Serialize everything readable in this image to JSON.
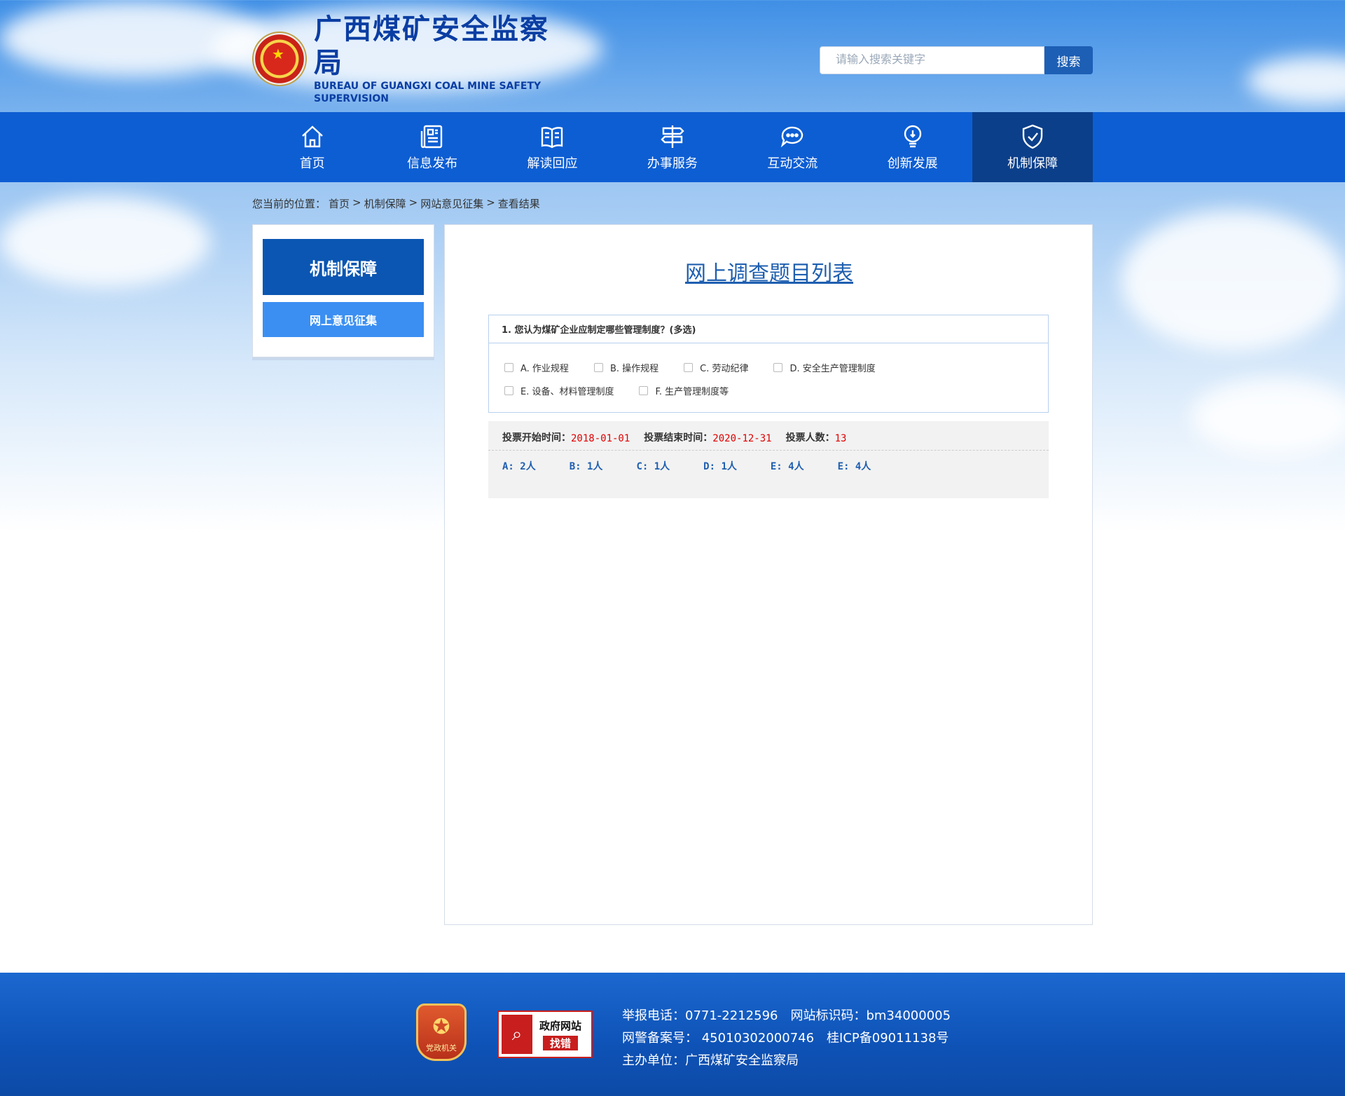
{
  "header": {
    "logo_cn": "广西煤矿安全监察局",
    "logo_en": "BUREAU OF GUANGXI COAL MINE SAFETY SUPERVISION",
    "search_placeholder": "请输入搜索关键字",
    "search_button": "搜索"
  },
  "nav": [
    {
      "label": "首页",
      "icon": "home-icon"
    },
    {
      "label": "信息发布",
      "icon": "newspaper-icon"
    },
    {
      "label": "解读回应",
      "icon": "book-icon"
    },
    {
      "label": "办事服务",
      "icon": "signpost-icon"
    },
    {
      "label": "互动交流",
      "icon": "chat-icon"
    },
    {
      "label": "创新发展",
      "icon": "lightbulb-icon"
    },
    {
      "label": "机制保障",
      "icon": "shield-check-icon",
      "active": true
    }
  ],
  "breadcrumb": {
    "prefix": "您当前的位置：",
    "items": [
      "首页",
      "机制保障",
      "网站意见征集",
      "查看结果"
    ],
    "sep": ">"
  },
  "sidebar": {
    "title": "机制保障",
    "items": [
      "网上意见征集"
    ]
  },
  "main": {
    "title": "网上调查题目列表",
    "question": "1. 您认为煤矿企业应制定哪些管理制度？(多选)",
    "options_row1": [
      "A. 作业规程",
      "B. 操作规程",
      "C. 劳动纪律",
      "D. 安全生产管理制度"
    ],
    "options_row2": [
      "E. 设备、材料管理制度",
      "F. 生产管理制度等"
    ],
    "stats": {
      "start_label": "投票开始时间：",
      "start_value": "2018-01-01",
      "end_label": "投票结束时间：",
      "end_value": "2020-12-31",
      "count_label": "投票人数：",
      "count_value": "13",
      "results": [
        "A: 2人",
        "B: 1人",
        "C: 1人",
        "D: 1人",
        "E: 4人",
        "E: 4人"
      ]
    }
  },
  "footer": {
    "badge1_label": "党政机关",
    "badge2_line1": "政府网站",
    "badge2_line2": "找错",
    "line1": "举报电话：0771-2212596　网站标识码：bm34000005",
    "line2": "网警备案号： 45010302000746　桂ICP备09011138号",
    "line3": "主办单位：广西煤矿安全监察局"
  },
  "colors": {
    "nav_bg": "#0d5ed3",
    "nav_active": "#0b3f8a",
    "accent_red": "#e00000",
    "link_blue": "#1f5fb0"
  }
}
